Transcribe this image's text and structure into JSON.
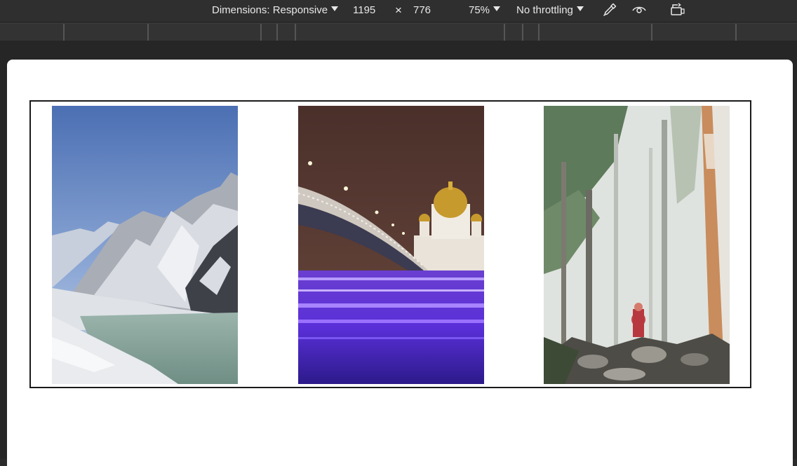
{
  "toolbar": {
    "dimensions_label": "Dimensions: Responsive",
    "width_value": "1195",
    "times_symbol": "×",
    "height_value": "776",
    "zoom": "75%",
    "throttling": "No throttling"
  },
  "icons": {
    "eyedropper": "eyedropper-icon",
    "vision": "eye-icon",
    "rotate": "rotate-device-icon"
  },
  "gallery": {
    "images": [
      {
        "subject": "snowy-mountain-lake"
      },
      {
        "subject": "cathedral-bridge-night"
      },
      {
        "subject": "foggy-forest-hiker"
      }
    ]
  }
}
